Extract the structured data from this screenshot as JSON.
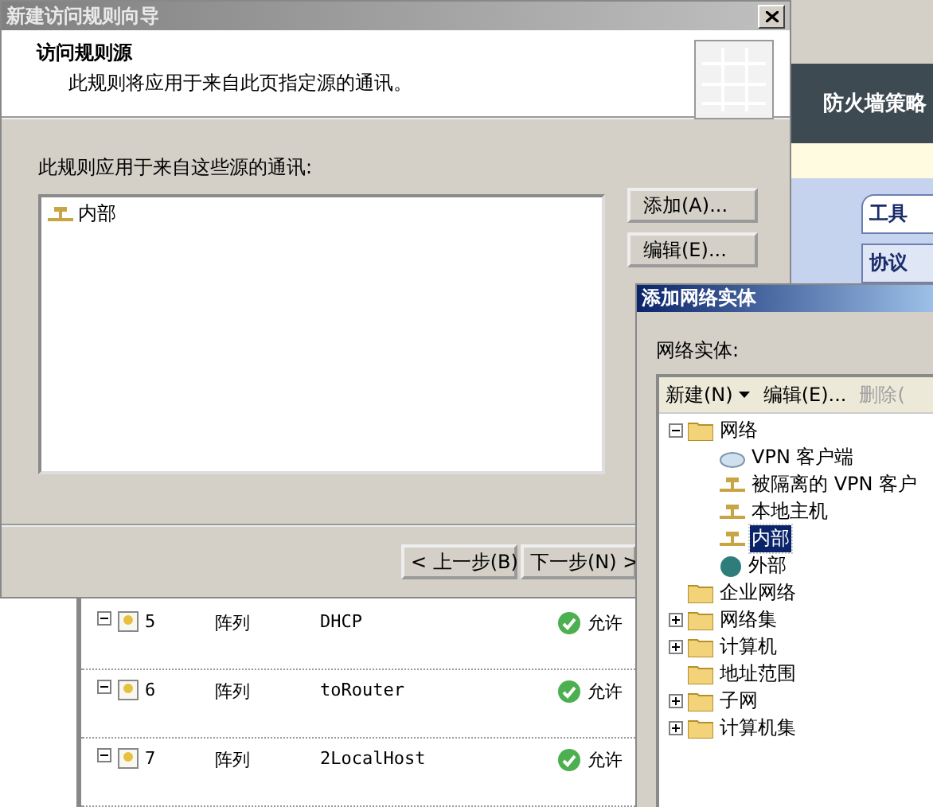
{
  "console": {
    "header_title": "防火墙策略",
    "tabs": [
      {
        "label": "工具",
        "selected": true
      },
      {
        "label": "协议",
        "selected": false
      }
    ],
    "rules": [
      {
        "number": "5",
        "source": "阵列",
        "name": "DHCP",
        "action": "允许"
      },
      {
        "number": "6",
        "source": "阵列",
        "name": "toRouter",
        "action": "允许"
      },
      {
        "number": "7",
        "source": "阵列",
        "name": "2LocalHost",
        "action": "允许"
      }
    ]
  },
  "wizard": {
    "title": "新建访问规则向导",
    "active": false,
    "heading": "访问规则源",
    "subheading": "此规则将应用于来自此页指定源的通讯。",
    "list_label": "此规则应用于来自这些源的通讯:",
    "sources": [
      {
        "label": "内部",
        "kind": "network"
      }
    ],
    "side_buttons": [
      "添加(A)...",
      "编辑(E)..."
    ],
    "nav_buttons": [
      "< 上一步(B)",
      "下一步(N) >"
    ]
  },
  "dialog": {
    "title": "添加网络实体",
    "active": true,
    "label": "网络实体:",
    "toolbar": [
      {
        "label": "新建(N)",
        "kind": "menu",
        "disabled": false
      },
      {
        "label": "编辑(E)...",
        "kind": "button",
        "disabled": false
      },
      {
        "label": "删除(",
        "kind": "button",
        "disabled": true
      }
    ],
    "tree": [
      {
        "label": "网络",
        "kind": "folder",
        "expanded": true,
        "selected": false,
        "children": [
          {
            "label": "VPN 客户端",
            "kind": "cloud",
            "selected": false
          },
          {
            "label": "被隔离的 VPN 客户",
            "kind": "network",
            "selected": false
          },
          {
            "label": "本地主机",
            "kind": "network",
            "selected": false
          },
          {
            "label": "内部",
            "kind": "network",
            "selected": true
          },
          {
            "label": "外部",
            "kind": "globe",
            "selected": false
          }
        ]
      },
      {
        "label": "企业网络",
        "kind": "folder",
        "selected": false
      },
      {
        "label": "网络集",
        "kind": "folder",
        "expanded": false,
        "selected": false
      },
      {
        "label": "计算机",
        "kind": "folder",
        "expanded": false,
        "selected": false
      },
      {
        "label": "地址范围",
        "kind": "folder",
        "selected": false
      },
      {
        "label": "子网",
        "kind": "folder",
        "expanded": false,
        "selected": false
      },
      {
        "label": "计算机集",
        "kind": "folder",
        "expanded": false,
        "selected": false
      }
    ]
  }
}
